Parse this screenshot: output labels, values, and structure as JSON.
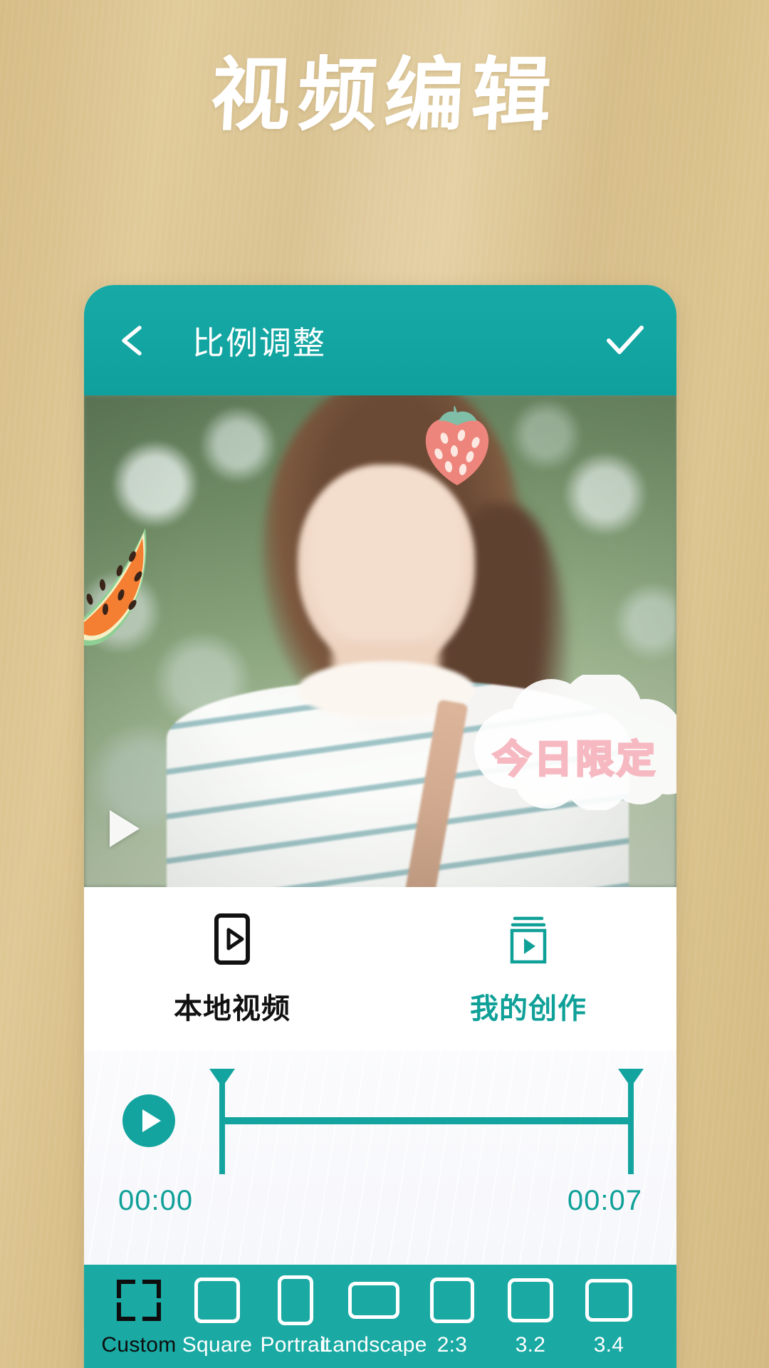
{
  "page": {
    "title": "视频编辑",
    "background_color": "#d9c08c",
    "accent_color": "#14a49f"
  },
  "appbar": {
    "back_icon": "arrow-left-icon",
    "title": "比例调整",
    "done_icon": "check-icon"
  },
  "preview": {
    "play_icon": "play-triangle-icon",
    "stickers": [
      {
        "name": "strawberry-sticker",
        "label": "strawberry"
      },
      {
        "name": "watermelon-sticker",
        "label": "watermelon"
      },
      {
        "name": "cloud-sticker",
        "label": "cloud",
        "text": "今日限定"
      }
    ]
  },
  "tabs": [
    {
      "label": "本地视频",
      "icon": "phone-play-icon",
      "active": true,
      "color": "#111111"
    },
    {
      "label": "我的创作",
      "icon": "stacked-frames-play-icon",
      "active": false,
      "color": "#0fa098"
    }
  ],
  "timeline": {
    "play_icon": "play-circle-icon",
    "start_time": "00:00",
    "end_time": "00:07"
  },
  "ratios": [
    {
      "label": "Custom",
      "icon": "crop-corners-icon",
      "selected": true
    },
    {
      "label": "Square",
      "icon": "square-icon",
      "selected": false
    },
    {
      "label": "Portrait",
      "icon": "portrait-icon",
      "selected": false
    },
    {
      "label": "Landscape",
      "icon": "landscape-icon",
      "selected": false
    },
    {
      "label": "2:3",
      "icon": "ratio-23-icon",
      "selected": false
    },
    {
      "label": "3.2",
      "icon": "ratio-32-icon",
      "selected": false
    },
    {
      "label": "3.4",
      "icon": "ratio-34-icon",
      "selected": false
    }
  ]
}
